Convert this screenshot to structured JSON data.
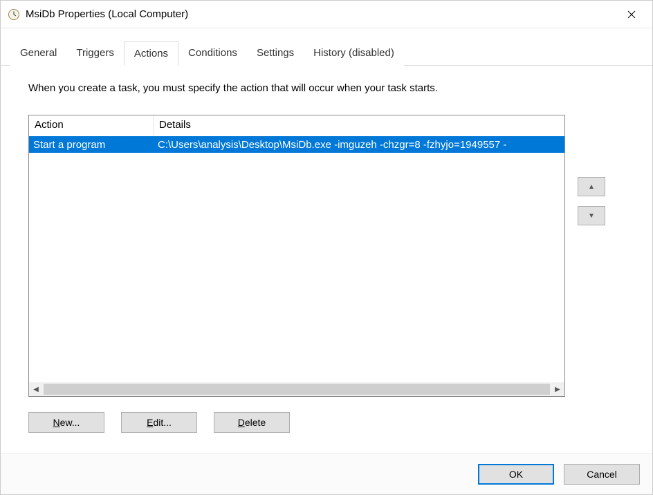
{
  "window": {
    "title": "MsiDb Properties (Local Computer)"
  },
  "tabs": {
    "general": "General",
    "triggers": "Triggers",
    "actions": "Actions",
    "conditions": "Conditions",
    "settings": "Settings",
    "history": "History (disabled)",
    "active": "actions"
  },
  "content": {
    "description": "When you create a task, you must specify the action that will occur when your task starts."
  },
  "listview": {
    "columns": {
      "action": "Action",
      "details": "Details"
    },
    "rows": [
      {
        "action": "Start a program",
        "details": "C:\\Users\\analysis\\Desktop\\MsiDb.exe -imguzeh -chzgr=8 -fzhyjo=1949557 -",
        "selected": true
      }
    ]
  },
  "buttons": {
    "new": "ew...",
    "new_mnemonic": "N",
    "edit": "dit...",
    "edit_mnemonic": "E",
    "delete": "elete",
    "delete_mnemonic": "D",
    "ok": "OK",
    "cancel": "Cancel"
  }
}
